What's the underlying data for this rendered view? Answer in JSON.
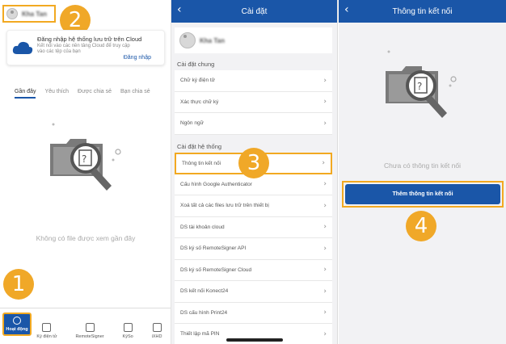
{
  "colors": {
    "primary": "#1a56a8",
    "highlight": "#f2a921",
    "badge": "#f0a828"
  },
  "steps": [
    "1",
    "2",
    "3",
    "4"
  ],
  "home": {
    "user_name": "Kha Tan",
    "cloud_card": {
      "title": "Đăng nhập hệ thống lưu trữ trên Cloud",
      "description": "Kết nối vào các nền tảng Cloud để truy cập vào các tệp của bạn",
      "login_label": "Đăng nhập"
    },
    "tabs": [
      "Gần đây",
      "Yêu thích",
      "Được chia sẻ",
      "Bạn chia sẻ"
    ],
    "empty_text": "Không có file được xem gần đây",
    "nav": [
      {
        "label": "Hoạt động",
        "icon": "history-icon"
      },
      {
        "label": "Ký điện tử",
        "icon": "pen-icon"
      },
      {
        "label": "RemoteSigner",
        "icon": "remote-signer-icon"
      },
      {
        "label": "KýSo",
        "icon": "lock-icon"
      },
      {
        "label": "iXHD",
        "icon": "invoice-icon"
      }
    ]
  },
  "settings": {
    "title": "Cài đặt",
    "user_name": "Kha Tan",
    "general_section": "Cài đặt chung",
    "general_items": [
      "Chữ ký điện tử",
      "Xác thực chữ ký",
      "Ngôn ngữ"
    ],
    "system_section": "Cài đặt hệ thống",
    "system_items": [
      "Thông tin kết nối",
      "Cấu hình Google Authenticator",
      "Xoá tất cả các files lưu trữ trên thiết bị",
      "DS tài khoản cloud",
      "DS ký số RemoteSigner API",
      "DS ký số RemoteSigner Cloud",
      "DS kết nối Konect24",
      "DS cấu hình Print24",
      "Thiết lập mã PIN"
    ]
  },
  "connection": {
    "title": "Thông tin kết nối",
    "empty_text": "Chưa có thông tin kết nối",
    "add_button": "Thêm thông tin kết nối"
  }
}
